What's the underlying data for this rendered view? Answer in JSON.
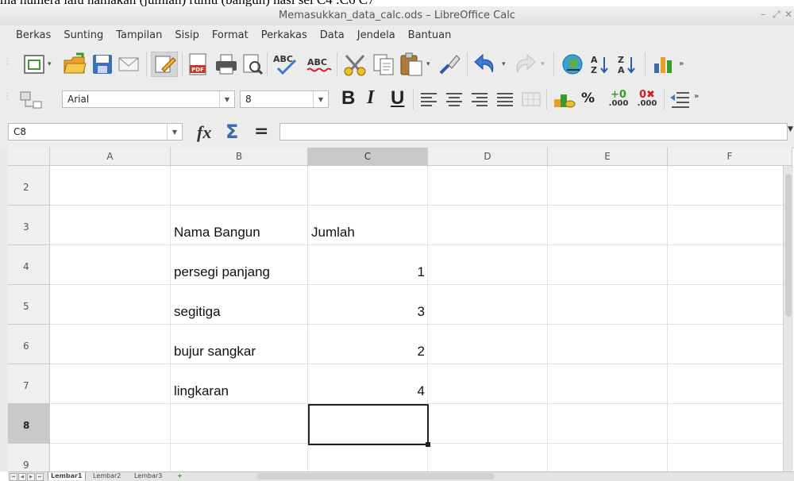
{
  "top_text": "ma numera lalu namakan (jumlah) rumu (bangun) hasi sel  C4 :C6 C7",
  "window": {
    "title": "Memasukkan_data_calc.ods – LibreOffice Calc",
    "min": "–",
    "max": "⤢",
    "close": "✕"
  },
  "menu": [
    "Berkas",
    "Sunting",
    "Tampilan",
    "Sisip",
    "Format",
    "Perkakas",
    "Data",
    "Jendela",
    "Bantuan"
  ],
  "formatting": {
    "font_name": "Arial",
    "font_size": "8",
    "bold": "B",
    "italic": "I",
    "underline": "U",
    "percent": "%",
    "add_decimal": ".000",
    "del_decimal": ".000"
  },
  "formula_bar": {
    "name_box": "C8",
    "fx": "fx",
    "sum": "Σ",
    "equals": "=",
    "input": ""
  },
  "columns": [
    "A",
    "B",
    "C",
    "D",
    "E",
    "F"
  ],
  "selected_column": "C",
  "rows": [
    {
      "num": "2",
      "B": "",
      "C": ""
    },
    {
      "num": "3",
      "B": "Nama Bangun",
      "C": "Jumlah"
    },
    {
      "num": "4",
      "B": "persegi panjang",
      "C": "1"
    },
    {
      "num": "5",
      "B": "segitiga",
      "C": "3"
    },
    {
      "num": "6",
      "B": "bujur sangkar",
      "C": "2"
    },
    {
      "num": "7",
      "B": "lingkaran",
      "C": "4"
    },
    {
      "num": "8",
      "B": "",
      "C": ""
    },
    {
      "num": "9",
      "B": "",
      "C": ""
    }
  ],
  "selected_row": "8",
  "sheets": [
    "Lembar1",
    "Lembar2",
    "Lembar3"
  ],
  "add_sheet": "+",
  "colors": {
    "accent_green": "#3a9a2a",
    "selection_header": "#c9c9c9",
    "toolbar_bg": "#ececec"
  }
}
